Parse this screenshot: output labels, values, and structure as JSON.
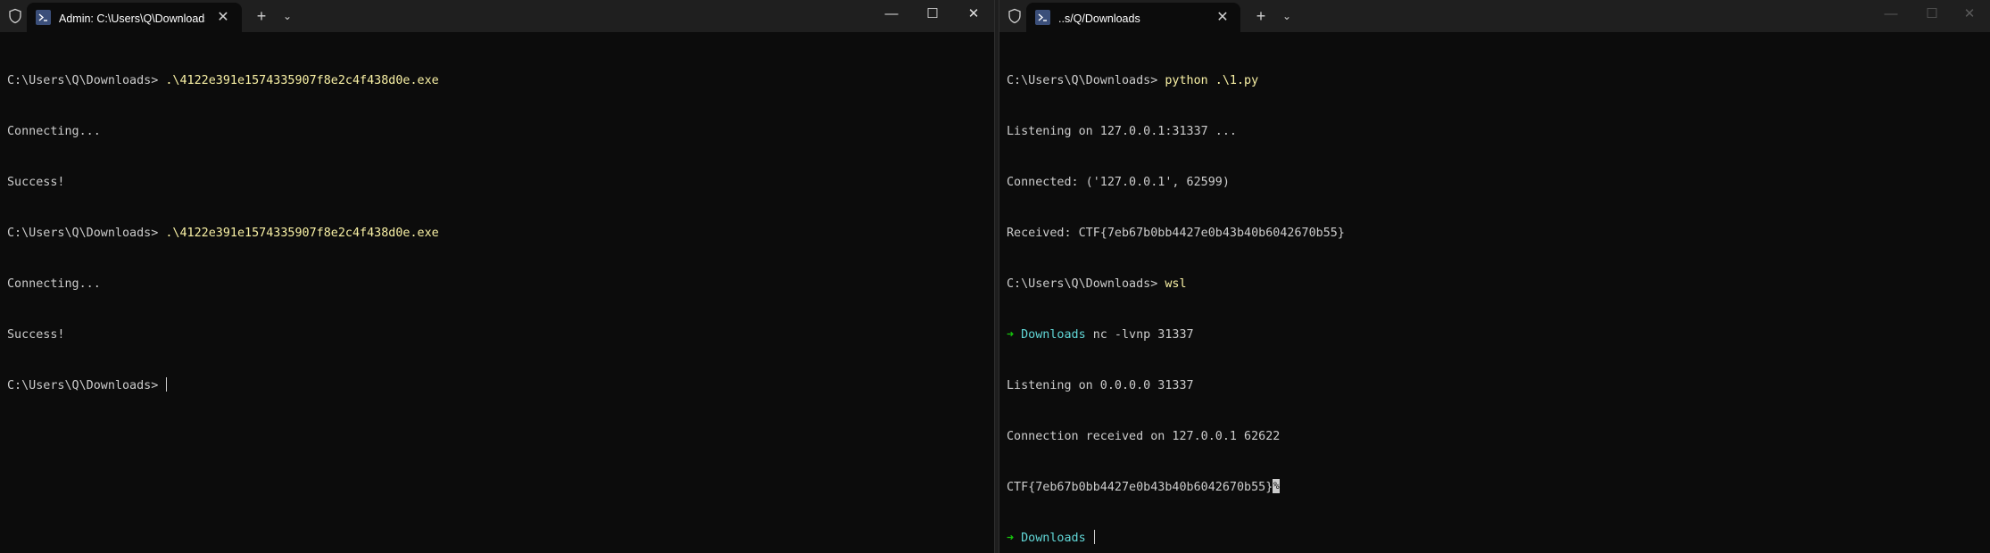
{
  "left_window": {
    "tab_title": "Admin: C:\\Users\\Q\\Downloads",
    "tab_close": "✕",
    "new_tab": "+",
    "dropdown": "⌄",
    "controls": {
      "minimize": "—",
      "maximize": "☐",
      "close": "✕"
    },
    "lines": {
      "l1_prompt": "C:\\Users\\Q\\Downloads> ",
      "l1_cmd": ".\\4122e391e1574335907f8e2c4f438d0e.exe",
      "l2": "Connecting...",
      "l3": "Success!",
      "l4_prompt": "C:\\Users\\Q\\Downloads> ",
      "l4_cmd": ".\\4122e391e1574335907f8e2c4f438d0e.exe",
      "l5": "Connecting...",
      "l6": "Success!",
      "l7_prompt": "C:\\Users\\Q\\Downloads> "
    }
  },
  "right_window": {
    "tab_title": "..s/Q/Downloads",
    "tab_close": "✕",
    "new_tab": "+",
    "dropdown": "⌄",
    "controls": {
      "minimize": "—",
      "maximize": "☐",
      "close": "✕"
    },
    "lines": {
      "l1_prompt": "C:\\Users\\Q\\Downloads> ",
      "l1_cmd": "python .\\1.py",
      "l2": "Listening on 127.0.0.1:31337 ...",
      "l3": "Connected: ('127.0.0.1', 62599)",
      "l4": "Received: CTF{7eb67b0bb4427e0b43b40b6042670b55}",
      "l5_prompt": "C:\\Users\\Q\\Downloads> ",
      "l5_cmd": "wsl",
      "l6_arrow": "➜ ",
      "l6_dir": "Downloads",
      "l6_cmd": " nc -lvnp 31337",
      "l7": "Listening on 0.0.0.0 31337",
      "l8": "Connection received on 127.0.0.1 62622",
      "l9": "CTF{7eb67b0bb4427e0b43b40b6042670b55}",
      "l9_mark": "%",
      "l10_arrow": "➜ ",
      "l10_dir": "Downloads"
    }
  },
  "colors": {
    "background": "#0c0c0c",
    "titlebar": "#1f1f1f",
    "text": "#cccccc",
    "command": "#f9f1a5",
    "prompt_arrow": "#16c60c",
    "directory": "#61d6d6"
  },
  "icons": [
    "shield-icon",
    "powershell-icon",
    "close-icon",
    "plus-icon",
    "chevron-down-icon",
    "minimize-icon",
    "maximize-icon"
  ]
}
